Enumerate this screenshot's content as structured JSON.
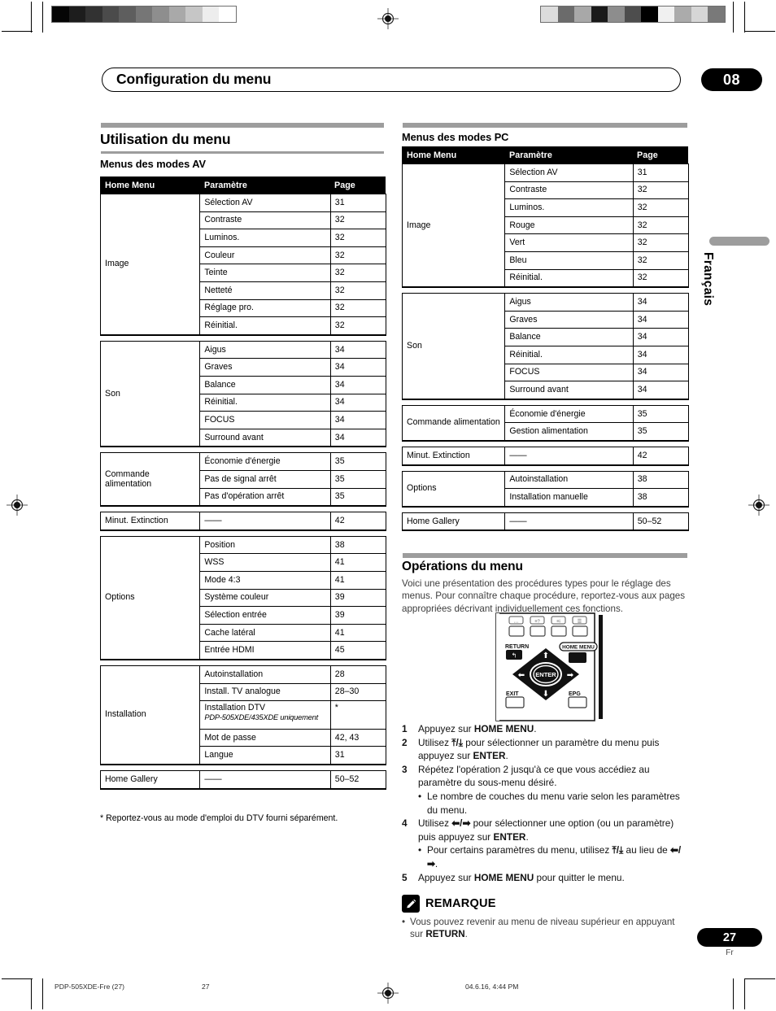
{
  "header": {
    "chapter_title": "Configuration du menu",
    "chapter_number": "08"
  },
  "side_tab": {
    "language": "Français"
  },
  "page_footer": {
    "page_number": "27",
    "language_code": "Fr",
    "file_label": "PDP-505XDE-Fre (27)",
    "sheet_number": "27",
    "timestamp": "04.6.16, 4:44 PM"
  },
  "left_column": {
    "section_title": "Utilisation du menu",
    "table_title": "Menus des modes AV",
    "columns": [
      "Home Menu",
      "Paramètre",
      "Page"
    ],
    "groups": [
      {
        "category": "Image",
        "rows": [
          {
            "param": "Sélection AV",
            "page": "31"
          },
          {
            "param": "Contraste",
            "page": "32"
          },
          {
            "param": "Luminos.",
            "page": "32"
          },
          {
            "param": "Couleur",
            "page": "32"
          },
          {
            "param": "Teinte",
            "page": "32"
          },
          {
            "param": "Netteté",
            "page": "32"
          },
          {
            "param": "Réglage pro.",
            "page": "32"
          },
          {
            "param": "Réinitial.",
            "page": "32"
          }
        ]
      },
      {
        "category": "Son",
        "rows": [
          {
            "param": "Aigus",
            "page": "34"
          },
          {
            "param": "Graves",
            "page": "34"
          },
          {
            "param": "Balance",
            "page": "34"
          },
          {
            "param": "Réinitial.",
            "page": "34"
          },
          {
            "param": "FOCUS",
            "page": "34"
          },
          {
            "param": "Surround avant",
            "page": "34"
          }
        ]
      },
      {
        "category": "Commande alimentation",
        "rows": [
          {
            "param": "Économie d'énergie",
            "page": "35"
          },
          {
            "param": "Pas de signal arrêt",
            "page": "35"
          },
          {
            "param": "Pas d'opération arrêt",
            "page": "35"
          }
        ]
      },
      {
        "category": "Minut. Extinction",
        "rows": [
          {
            "param": "——",
            "page": "42"
          }
        ]
      },
      {
        "category": "Options",
        "rows": [
          {
            "param": "Position",
            "page": "38"
          },
          {
            "param": "WSS",
            "page": "41"
          },
          {
            "param": "Mode 4:3",
            "page": "41"
          },
          {
            "param": "Système couleur",
            "page": "39"
          },
          {
            "param": "Sélection entrée",
            "page": "39"
          },
          {
            "param": "Cache latéral",
            "page": "41"
          },
          {
            "param": "Entrée HDMI",
            "page": "45"
          }
        ]
      },
      {
        "category": "Installation",
        "rows": [
          {
            "param": "Autoinstallation",
            "page": "28"
          },
          {
            "param": "Install. TV analogue",
            "page": "28–30"
          },
          {
            "param": "Installation DTV",
            "param_sub": "PDP-505XDE/435XDE uniquement",
            "page": "*"
          },
          {
            "param": "Mot de passe",
            "page": "42, 43"
          },
          {
            "param": "Langue",
            "page": "31"
          }
        ]
      },
      {
        "category": "Home Gallery",
        "rows": [
          {
            "param": "——",
            "page": "50–52"
          }
        ]
      }
    ],
    "footnote": "* Reportez-vous au mode d'emploi du DTV fourni séparément."
  },
  "right_column": {
    "table_title": "Menus des modes PC",
    "columns": [
      "Home Menu",
      "Paramètre",
      "Page"
    ],
    "groups": [
      {
        "category": "Image",
        "rows": [
          {
            "param": "Sélection AV",
            "page": "31"
          },
          {
            "param": "Contraste",
            "page": "32"
          },
          {
            "param": "Luminos.",
            "page": "32"
          },
          {
            "param": "Rouge",
            "page": "32"
          },
          {
            "param": "Vert",
            "page": "32"
          },
          {
            "param": "Bleu",
            "page": "32"
          },
          {
            "param": "Réinitial.",
            "page": "32"
          }
        ]
      },
      {
        "category": "Son",
        "rows": [
          {
            "param": "Aigus",
            "page": "34"
          },
          {
            "param": "Graves",
            "page": "34"
          },
          {
            "param": "Balance",
            "page": "34"
          },
          {
            "param": "Réinitial.",
            "page": "34"
          },
          {
            "param": "FOCUS",
            "page": "34"
          },
          {
            "param": "Surround avant",
            "page": "34"
          }
        ]
      },
      {
        "category": "Commande alimentation",
        "rows": [
          {
            "param": "Économie d'énergie",
            "page": "35"
          },
          {
            "param": "Gestion alimentation",
            "page": "35"
          }
        ]
      },
      {
        "category": "Minut. Extinction",
        "rows": [
          {
            "param": "——",
            "page": "42"
          }
        ]
      },
      {
        "category": "Options",
        "rows": [
          {
            "param": "Autoinstallation",
            "page": "38"
          },
          {
            "param": "Installation manuelle",
            "page": "38"
          }
        ]
      },
      {
        "category": "Home Gallery",
        "rows": [
          {
            "param": "——",
            "page": "50–52"
          }
        ]
      }
    ],
    "operations": {
      "title": "Opérations du menu",
      "intro": "Voici une présentation des procédures types pour le réglage des menus. Pour connaître chaque procédure, reportez-vous aux pages appropriées décrivant individuellement ces fonctions.",
      "remote": {
        "return_label": "RETURN",
        "home_menu_label": "HOME MENU",
        "enter_label": "ENTER",
        "exit_label": "EXIT",
        "epg_label": "EPG"
      },
      "steps": [
        {
          "n": "1",
          "html": "Appuyez sur <b>HOME MENU</b>."
        },
        {
          "n": "2",
          "html": "Utilisez <b>&#10514;/&#10515;</b> pour sélectionner un paramètre du menu puis appuyez sur <b>ENTER</b>."
        },
        {
          "n": "3",
          "html": "Répétez l'opération 2 jusqu'à ce que vous accédiez au paramètre du sous-menu désiré.",
          "bullets": [
            "Le nombre de couches du menu varie selon les paramètres du menu."
          ]
        },
        {
          "n": "4",
          "html": "Utilisez <b>&#11013;/&#10145;</b> pour sélectionner une option (ou un paramètre) puis appuyez sur  <b>ENTER</b>.",
          "bullets": [
            "Pour certains paramètres du menu, utilisez <b>&#10514;/&#10515;</b> au lieu de <b>&#11013;/&#10145;</b>."
          ]
        },
        {
          "n": "5",
          "html": "Appuyez sur <b>HOME MENU</b> pour quitter le menu."
        }
      ],
      "note": {
        "title": "REMARQUE",
        "items": [
          "Vous pouvez revenir au menu de niveau supérieur en appuyant sur <b>RETURN</b>."
        ]
      }
    }
  },
  "print_marks": {
    "gray_strip_left": [
      "#050505",
      "#1d1d1d",
      "#323232",
      "#4b4b4b",
      "#5e5e5e",
      "#767676",
      "#8e8e8e",
      "#a9a9a9",
      "#c6c6c6",
      "#ededed",
      "#ffffff"
    ],
    "gray_strip_right": [
      "#dcdcdc",
      "#6b6b6b",
      "#a8a8a8",
      "#1a1a1a",
      "#8d8d8d",
      "#4d4d4d",
      "#000000",
      "#f0f0f0",
      "#ababab",
      "#d6d6d6",
      "#797979"
    ]
  }
}
